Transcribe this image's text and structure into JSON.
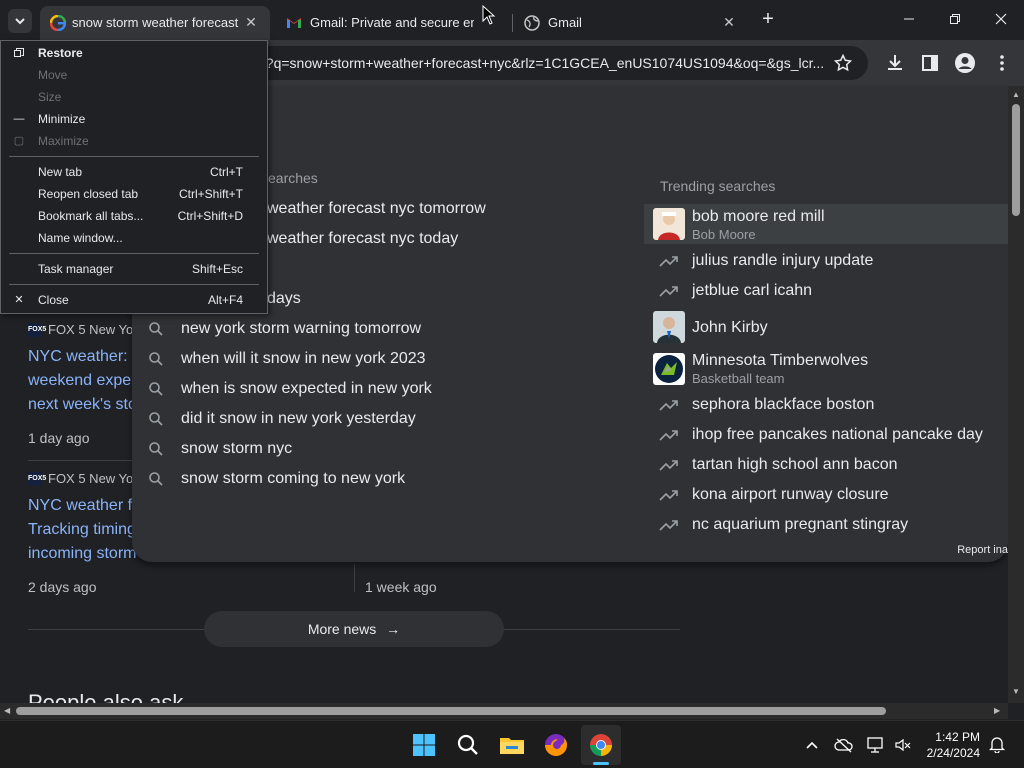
{
  "tabs": [
    {
      "title": "snow storm weather forecast nyc",
      "icon": "google-g-icon"
    },
    {
      "title": "Gmail: Private and secure email",
      "icon": "gmail-icon"
    },
    {
      "title": "Gmail",
      "icon": "globe-icon"
    }
  ],
  "omnibox": {
    "url": "h?q=snow+storm+weather+forecast+nyc&rlz=1C1GCEA_enUS1074US1094&oq=&gs_lcr..."
  },
  "context_menu": {
    "items": [
      {
        "label": "Restore",
        "icon": "restore-icon",
        "enabled": true,
        "bold": true
      },
      {
        "label": "Move",
        "enabled": false
      },
      {
        "label": "Size",
        "enabled": false
      },
      {
        "label": "Minimize",
        "icon": "minimize-icon",
        "enabled": true
      },
      {
        "label": "Maximize",
        "icon": "maximize-icon",
        "enabled": false
      },
      {
        "label": "New tab",
        "shortcut": "Ctrl+T",
        "enabled": true
      },
      {
        "label": "Reopen closed tab",
        "shortcut": "Ctrl+Shift+T",
        "enabled": true
      },
      {
        "label": "Bookmark all tabs...",
        "shortcut": "Ctrl+Shift+D",
        "enabled": true
      },
      {
        "label": "Name window...",
        "enabled": true
      },
      {
        "label": "Task manager",
        "shortcut": "Shift+Esc",
        "enabled": true
      },
      {
        "label": "Close",
        "icon": "close-icon",
        "shortcut": "Alt+F4",
        "enabled": true
      }
    ]
  },
  "suggestions": {
    "header_partial": "earches",
    "partial_items": [
      "weather forecast nyc tomorrow",
      "weather forecast nyc today",
      "days"
    ],
    "items": [
      "new york storm warning tomorrow",
      "when will it snow in new york 2023",
      "when is snow expected in new york",
      "did it snow in new york yesterday",
      "snow storm nyc",
      "snow storm coming to new york"
    ]
  },
  "trending": {
    "heading": "Trending searches",
    "items": [
      {
        "title": "bob moore red mill",
        "subtitle": "Bob Moore",
        "thumb": true
      },
      {
        "title": "julius randle injury update"
      },
      {
        "title": "jetblue carl icahn"
      },
      {
        "title": "John Kirby",
        "thumb": true
      },
      {
        "title": "Minnesota Timberwolves",
        "subtitle": "Basketball team",
        "thumb": true
      },
      {
        "title": "sephora blackface boston"
      },
      {
        "title": "ihop free pancakes national pancake day"
      },
      {
        "title": "tartan high school ann bacon"
      },
      {
        "title": "kona airport runway closure"
      },
      {
        "title": "nc aquarium pregnant stingray"
      }
    ],
    "report": "Report ina"
  },
  "news": {
    "cards": [
      {
        "source": "FOX 5 New Yo",
        "title_lines": [
          "NYC weather:",
          "weekend expe",
          "next week's sto"
        ],
        "date": "1 day ago"
      },
      {
        "source": "FOX 5 New Yo",
        "title_lines": [
          "NYC weather f",
          "Tracking timing",
          "incoming storm"
        ],
        "date": "2 days ago"
      }
    ],
    "second_col_date": "1 week ago",
    "more_news": "More news",
    "people_also_ask": "People also ask"
  },
  "taskbar": {
    "time": "1:42 PM",
    "date": "2/24/2024"
  }
}
